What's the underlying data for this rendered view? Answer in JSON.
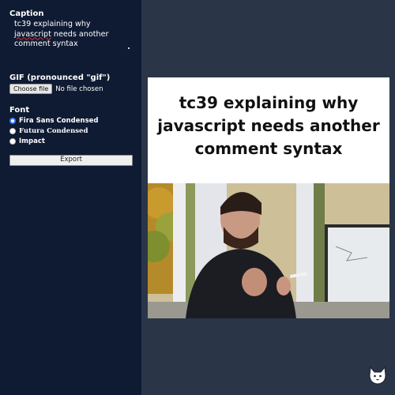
{
  "sidebar": {
    "caption_label": "Caption",
    "caption_lines": [
      {
        "text_before": "tc39 explaining why",
        "squiggle": "",
        "text_after": ""
      },
      {
        "text_before": "",
        "squiggle": "javascript",
        "text_after": " needs another"
      },
      {
        "text_before": "comment syntax",
        "squiggle": "",
        "text_after": ""
      }
    ],
    "gif_label": "GIF (pronounced \"gif\")",
    "file_button_label": "Choose file",
    "file_status": "No file chosen",
    "font_label": "Font",
    "fonts": [
      {
        "label": "Fira Sans Condensed",
        "selected": true
      },
      {
        "label": "Futura Condensed",
        "selected": false
      },
      {
        "label": "Impact",
        "selected": false
      }
    ],
    "export_label": "Export"
  },
  "preview": {
    "caption_lines": [
      "tc39 explaining why",
      "javascript needs another",
      "comment syntax"
    ]
  },
  "icons": {
    "logo": "corgi-icon",
    "radio": "radio-icon"
  },
  "colors": {
    "sidebar_bg": "#0f1b33",
    "page_bg": "#2a3547",
    "accent": "#3a7bff",
    "spellcheck": "#e0302f"
  }
}
